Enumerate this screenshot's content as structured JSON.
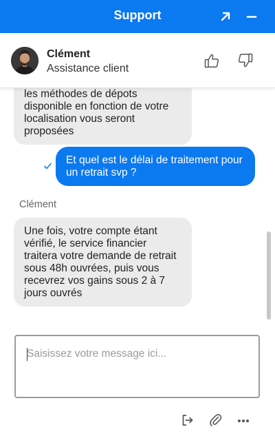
{
  "header": {
    "title": "Support",
    "accent_color": "#0b79ef",
    "icons": {
      "popout": "popout-arrow-icon",
      "minimize": "minimize-icon"
    }
  },
  "agent": {
    "name": "Clément",
    "role": "Assistance client",
    "icons": {
      "rate_up": "thumbs-up-icon",
      "rate_down": "thumbs-down-icon"
    }
  },
  "messages": [
    {
      "from": "agent",
      "text": "les méthodes de dépots disponible en fonction de votre localisation vous seront proposées"
    },
    {
      "from": "user",
      "text": "Et quel est le délai de traitement pour un retrait svp ?",
      "status_icon": "checkmark-icon"
    },
    {
      "from": "agent",
      "sender_label": "Clément",
      "text": "Une fois, votre compte étant vérifié, le service financier traitera votre demande de retrait sous 48h ouvrées, puis vous recevrez vos gains sous 2 à 7 jours ouvrés"
    }
  ],
  "composer": {
    "placeholder": "Saisissez votre message ici...",
    "value": ""
  },
  "footer": {
    "icons": [
      "exit-chat-icon",
      "paperclip-icon",
      "more-options-icon"
    ]
  }
}
